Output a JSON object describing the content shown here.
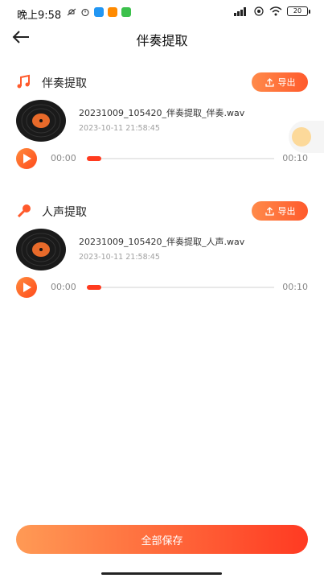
{
  "status_bar": {
    "time": "晚上9:58",
    "battery": "20",
    "app_colors": [
      "#2196F3",
      "#FF8A00",
      "#3CC14C"
    ]
  },
  "header": {
    "title": "伴奏提取",
    "back_icon": "arrow-left-icon"
  },
  "sections": [
    {
      "title": "伴奏提取",
      "icon": "music-note-icon",
      "export_label": "导出",
      "file_name": "20231009_105420_伴奏提取_伴奏.wav",
      "file_date": "2023-10-11 21:58:45",
      "current_time": "00:00",
      "total_time": "00:10",
      "progress": 0.0
    },
    {
      "title": "人声提取",
      "icon": "microphone-icon",
      "export_label": "导出",
      "file_name": "20231009_105420_伴奏提取_人声.wav",
      "file_date": "2023-10-11 21:58:45",
      "current_time": "00:00",
      "total_time": "00:10",
      "progress": 0.0
    }
  ],
  "save_all_label": "全部保存",
  "colors": {
    "accent": "#FF5A2C",
    "accent_light": "#FF8A4A"
  }
}
